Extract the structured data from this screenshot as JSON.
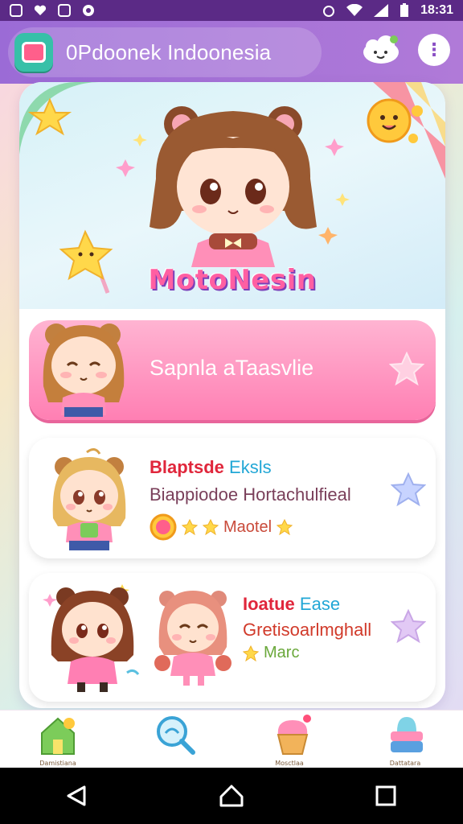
{
  "status_bar": {
    "time": "18:31",
    "icons_left": [
      "app-icon",
      "heart-icon",
      "grid-icon",
      "settings-icon"
    ],
    "icons_right": [
      "alarm-icon",
      "wifi-icon",
      "signal-icon",
      "battery-icon"
    ]
  },
  "app_bar": {
    "title": "0Pdoonek Indoonesia",
    "logo_icon": "app-logo-icon",
    "actions": [
      "cloud-smile-icon",
      "more-vert-icon"
    ]
  },
  "hero": {
    "label": "MotoNesin",
    "decorations": [
      "star-icon",
      "sun-icon",
      "star-wand-icon"
    ]
  },
  "list": {
    "featured": {
      "label": "Sapnla aTaasvlie",
      "icon": "star-icon"
    },
    "items": [
      {
        "title_red": "Blaptsde",
        "title_blue": "Eksls",
        "subtitle": "Biappiodoe Hortachulfieal",
        "meta_label": "Maotel",
        "stars": 3
      },
      {
        "title_red": "Ioatue",
        "title_blue": "Ease",
        "subtitle": "Gretisoarlmghall",
        "meta_label": "Marc",
        "stars": 1
      }
    ]
  },
  "bottom_nav": {
    "items": [
      {
        "label": "Damistiana",
        "icon": "house-icon"
      },
      {
        "label": "",
        "icon": "search-icon"
      },
      {
        "label": "Mosctlaa",
        "icon": "cupcake-icon"
      },
      {
        "label": "Dattatara",
        "icon": "cake-icon"
      }
    ]
  },
  "system_nav": [
    "back-icon",
    "home-icon",
    "recents-icon"
  ],
  "colors": {
    "status_bar": "#5b2a86",
    "app_bar": "#9b6bd6",
    "featured_pink": "#ff7fb3",
    "title_red": "#e0263b",
    "title_blue": "#22a7d6"
  }
}
